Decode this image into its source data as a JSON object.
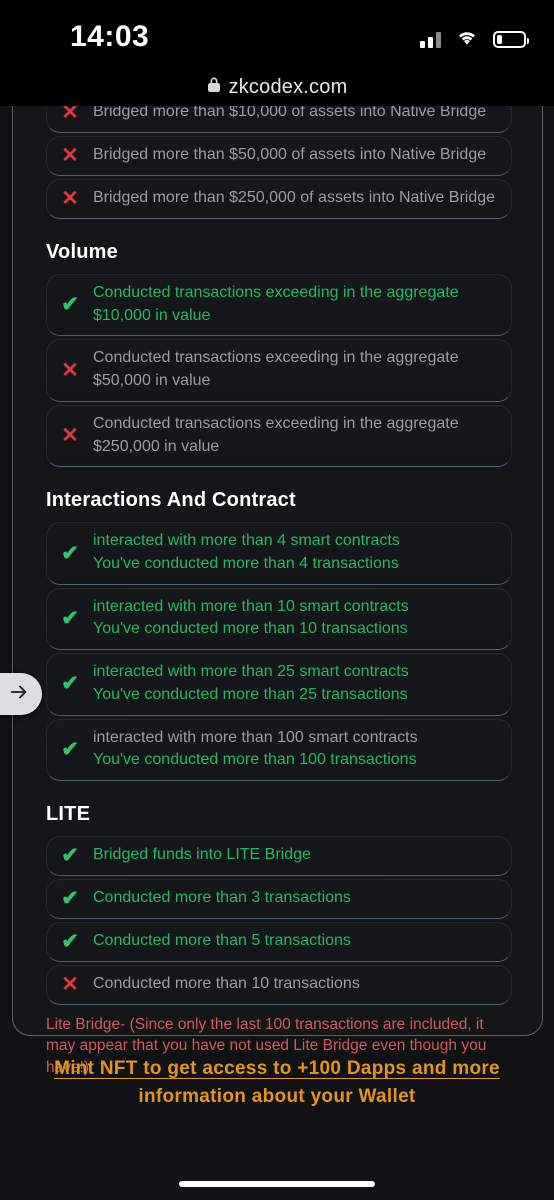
{
  "status_bar": {
    "time": "14:03",
    "cell_icon": "cell-signal-icon",
    "wifi_icon": "wifi-icon",
    "battery_icon": "battery-low-icon",
    "battery_level_pct": 17
  },
  "browser": {
    "lock_icon": "lock-icon",
    "url": "zkcodex.com"
  },
  "overlay": {
    "back_tab_icon": "arrow-right-icon",
    "back_tab_glyph": "→"
  },
  "marks": {
    "check_glyph": "✔",
    "cross_glyph": "✕",
    "check_color": "#2fc56c",
    "cross_color": "#e0383f"
  },
  "sections": [
    {
      "title": "",
      "title_visible": false,
      "rows": [
        {
          "status": "no",
          "lines": [
            {
              "text": "Bridged more than $10,000 of assets into Native Bridge",
              "tone": "gray"
            }
          ],
          "clipped": true
        },
        {
          "status": "no",
          "lines": [
            {
              "text": "Bridged more than $50,000 of assets into Native Bridge",
              "tone": "gray"
            }
          ]
        },
        {
          "status": "no",
          "lines": [
            {
              "text": "Bridged more than $250,000 of assets into Native Bridge",
              "tone": "gray"
            }
          ]
        }
      ]
    },
    {
      "title": "Volume",
      "title_visible": true,
      "rows": [
        {
          "status": "ok",
          "lines": [
            {
              "text": "Conducted transactions exceeding in the aggregate $10,000 in value",
              "tone": "ok"
            }
          ]
        },
        {
          "status": "no",
          "lines": [
            {
              "text": "Conducted transactions exceeding in the aggregate $50,000 in value",
              "tone": "gray"
            }
          ]
        },
        {
          "status": "no",
          "lines": [
            {
              "text": "Conducted transactions exceeding in the aggregate $250,000 in value",
              "tone": "gray"
            }
          ]
        }
      ]
    },
    {
      "title": "Interactions And Contract",
      "title_visible": true,
      "rows": [
        {
          "status": "ok",
          "lines": [
            {
              "text": "interacted with more than 4 smart contracts",
              "tone": "ok"
            },
            {
              "text": "You've conducted more than 4 transactions",
              "tone": "ok"
            }
          ]
        },
        {
          "status": "ok",
          "lines": [
            {
              "text": "interacted with more than 10 smart contracts",
              "tone": "ok"
            },
            {
              "text": "You've conducted more than 10 transactions",
              "tone": "ok"
            }
          ]
        },
        {
          "status": "ok",
          "lines": [
            {
              "text": "interacted with more than 25 smart contracts",
              "tone": "ok"
            },
            {
              "text": "You've conducted more than 25 transactions",
              "tone": "ok"
            }
          ]
        },
        {
          "status": "ok",
          "lines": [
            {
              "text": "interacted with more than 100 smart contracts",
              "tone": "gray"
            },
            {
              "text": "You've conducted more than 100 transactions",
              "tone": "ok"
            }
          ]
        }
      ]
    },
    {
      "title": "LITE",
      "title_visible": true,
      "rows": [
        {
          "status": "ok",
          "lines": [
            {
              "text": "Bridged funds into LITE Bridge",
              "tone": "ok"
            }
          ]
        },
        {
          "status": "ok",
          "lines": [
            {
              "text": "Conducted more than 3 transactions",
              "tone": "ok"
            }
          ]
        },
        {
          "status": "ok",
          "lines": [
            {
              "text": "Conducted more than 5 transactions",
              "tone": "ok"
            }
          ]
        },
        {
          "status": "no",
          "lines": [
            {
              "text": "Conducted more than 10 transactions",
              "tone": "gray"
            }
          ]
        }
      ],
      "note": "Lite Bridge- (Since only the last 100 transactions are included, it may appear that you have not used Lite Bridge even though you have!)"
    }
  ],
  "cta": {
    "line1": "Mint NFT to get access to +100 Dapps and more",
    "line2": "information about your Wallet",
    "color": "#e8921e"
  }
}
